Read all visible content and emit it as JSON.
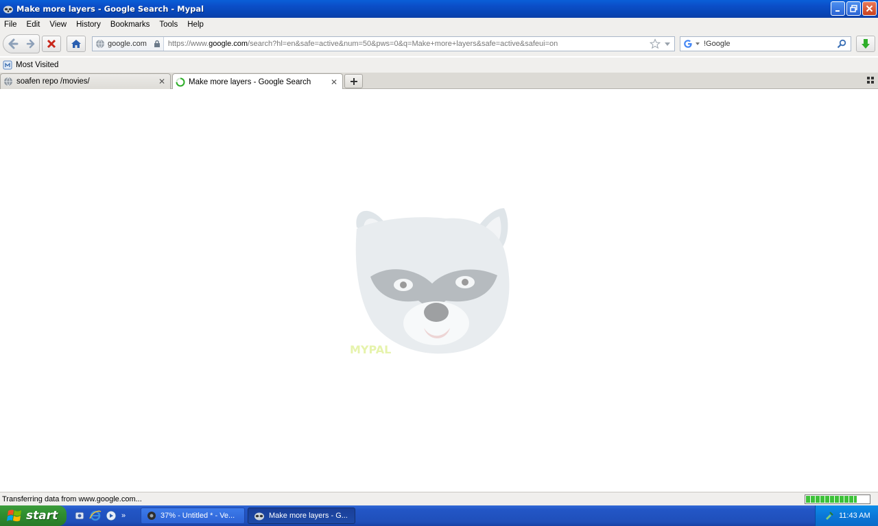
{
  "window": {
    "title": "Make more layers - Google Search - Mypal",
    "controls": {
      "minimize": "minimize",
      "restore": "restore",
      "close": "close"
    }
  },
  "menu": [
    "File",
    "Edit",
    "View",
    "History",
    "Bookmarks",
    "Tools",
    "Help"
  ],
  "navbar": {
    "identity_domain": "google.com",
    "url_prefix": "https://www.",
    "url_host": "google.com",
    "url_rest": "/search?hl=en&safe=active&num=50&pws=0&q=Make+more+layers&safe=active&safeui=on",
    "search_engine": "Google",
    "search_query": "!Google"
  },
  "bookmarks": {
    "most_visited": "Most Visited"
  },
  "tabs": [
    {
      "label": "soafen repo /movies/",
      "selected": false
    },
    {
      "label": "Make more layers - Google Search",
      "selected": true,
      "loading": true
    }
  ],
  "content": {
    "loading_art_caption": "MYPAL"
  },
  "status": {
    "text": "Transferring data from www.google.com...",
    "progress_percent": 80
  },
  "taskbar": {
    "start_label": "start",
    "tasks": [
      {
        "label": "37% - Untitled * - Ve...",
        "active": false
      },
      {
        "label": "Make more layers - G...",
        "active": true
      }
    ],
    "clock": "11:43 AM",
    "quicklaunch_more": "»"
  },
  "colors": {
    "titlebar": "#0a5fd8",
    "taskbar": "#2356c6",
    "start_green": "#2f8f2f",
    "tray": "#0b77d8",
    "progress_green": "#3ec23a"
  }
}
